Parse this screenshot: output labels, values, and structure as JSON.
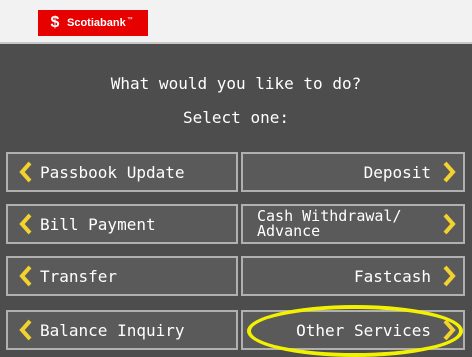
{
  "brand": {
    "name": "Scotiabank",
    "color": "#e60000"
  },
  "prompt": {
    "line1": "What would you like to do?",
    "line2": "Select one:"
  },
  "options": {
    "passbook_update": "Passbook Update",
    "deposit": "Deposit",
    "bill_payment": "Bill Payment",
    "cash_withdrawal_line1": "Cash Withdrawal/",
    "cash_withdrawal_line2": "Advance",
    "transfer": "Transfer",
    "fastcash": "Fastcash",
    "balance_inquiry": "Balance Inquiry",
    "other_services": "Other Services"
  },
  "colors": {
    "background": "#4d4d4d",
    "button": "#5a5a5a",
    "chevron": "#f2d22e",
    "highlight_ring": "#f2f200"
  },
  "icons": {
    "chevron_left": "chevron-left-icon",
    "chevron_right": "chevron-right-icon"
  }
}
